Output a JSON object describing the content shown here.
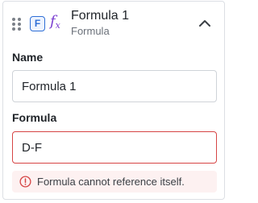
{
  "header": {
    "type_badge": "F",
    "fx_label": "f",
    "fx_sub": "x",
    "title": "Formula 1",
    "subtitle": "Formula"
  },
  "fields": {
    "name": {
      "label": "Name",
      "value": "Formula 1"
    },
    "formula": {
      "label": "Formula",
      "value": "D-F"
    }
  },
  "error": {
    "message": "Formula cannot reference itself."
  },
  "icons": {
    "drag": "drag-handle-icon",
    "badge": "formula-type-badge",
    "fx": "fx-icon",
    "collapse": "chevron-up-icon",
    "error": "info-circle-icon"
  },
  "colors": {
    "accent": "#2f6fd6",
    "fx": "#7b3fd1",
    "error": "#d64545",
    "error_bg": "#fdf1f1"
  }
}
